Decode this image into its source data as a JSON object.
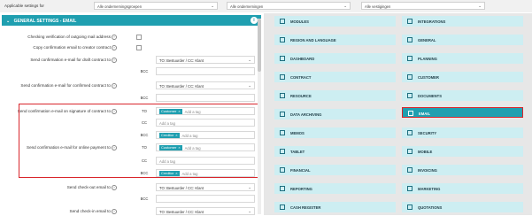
{
  "topbar": {
    "label": "Applicable settings for",
    "select1": "Alle ondernemingsgroepen",
    "select2": "Alle ondernemingen",
    "select3": "Alle vestigingen"
  },
  "section": {
    "title": "GENERAL SETTINGS - EMAIL",
    "info": "i"
  },
  "rows": {
    "verif_label": "Checking verification of outgoing mail address",
    "copyconf_label": "Copy confirmation email to creator contract",
    "draft_label": "Send confirmation e-mail for draft contract to",
    "draft_to": "TO: Bestuurder / CC: Klant",
    "draft_bcc": "BCC",
    "confirmed_label": "Send confirmation e-mail for confirmed contract to",
    "confirmed_to": "TO: Bestuurder / CC: Klant",
    "confirmed_bcc": "BCC",
    "signature_label": "Send confirmation e-mail on signature of contract to",
    "sig_to": "TO",
    "sig_to_tag": "Customer",
    "sig_cc": "CC",
    "sig_bcc": "BCC",
    "sig_bcc_tag": "Creditor",
    "online_label": "Send confirmation e-mail for online payment to",
    "op_to": "TO",
    "op_to_tag": "Customer",
    "op_cc": "CC",
    "op_bcc": "BCC",
    "op_bcc_tag": "Creditor",
    "add_tag": "Add a tag",
    "tag_x": "×",
    "checkout_label": "Send check-out email to",
    "checkout_to": "TO: Bestuurder / CC: Klant",
    "checkout_bcc": "BCC",
    "checkin_label": "Send check-in email to",
    "checkin_to": "TO: Bestuurder / CC: Klant",
    "help": "?"
  },
  "tiles": {
    "modules": "MODULES",
    "integrations": "INTEGRATIONS",
    "region": "REGION AND LANGUAGE",
    "general": "GENERAL",
    "dashboard": "DASHBOARD",
    "planning": "PLANNING",
    "contract": "CONTRACT",
    "customer": "CUSTOMER",
    "resource": "RESOURCE",
    "documents": "DOCUMENTS",
    "archiving": "DATA ARCHIVING",
    "email": "EMAIL",
    "memos": "MEMOS",
    "security": "SECURITY",
    "tablet": "TABLET",
    "mobile": "MOBILE",
    "financial": "FINANCIAL",
    "invoicing": "INVOICING",
    "reporting": "REPORTING",
    "marketing": "MARKETING",
    "cash": "CASH REGISTER",
    "quotations": "QUOTATIONS"
  },
  "colors": {
    "accent": "#1f9fb0",
    "highlight": "#d9262c",
    "tile_bg": "#cdeef2"
  }
}
